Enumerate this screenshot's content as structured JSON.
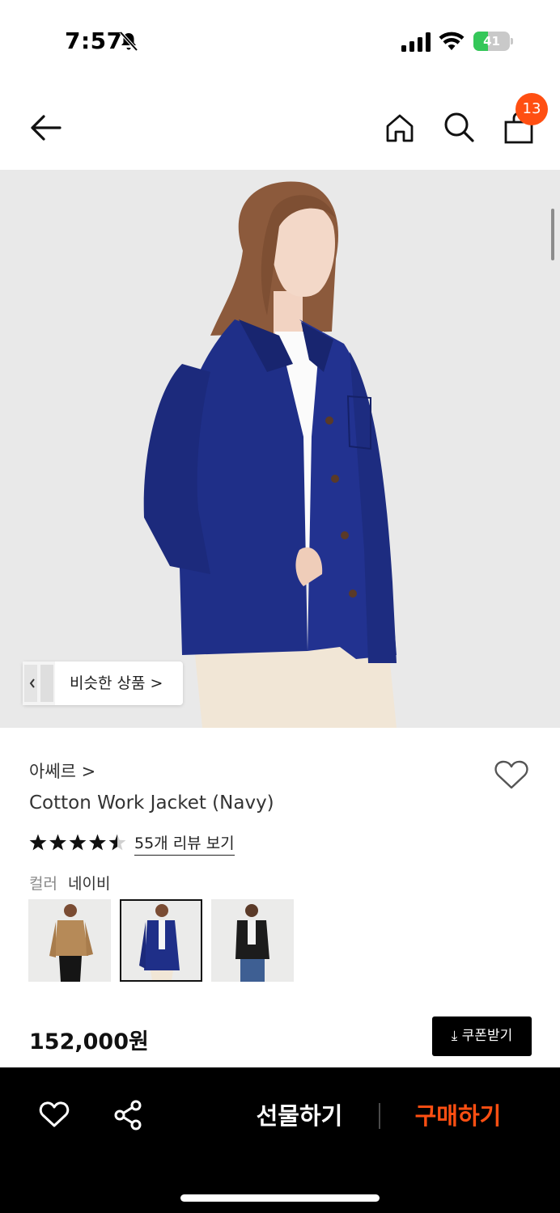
{
  "status_bar": {
    "time": "7:57",
    "battery_level": "41",
    "battery_fraction": 0.41
  },
  "header": {
    "cart_count": "13"
  },
  "colors": {
    "accent": "#ff4f12",
    "navy": "#1f2f88"
  },
  "hero": {
    "similar_products_label": "비슷한 상품 >"
  },
  "product": {
    "brand": "아쎄르 >",
    "name": "Cotton Work Jacket (Navy)",
    "rating": 4.5,
    "review_link": "55개 리뷰 보기",
    "color_label": "컬러",
    "color_value": "네이비",
    "swatches": [
      {
        "name": "camel",
        "selected": false
      },
      {
        "name": "navy",
        "selected": true
      },
      {
        "name": "black",
        "selected": false
      }
    ],
    "price": "152,000원",
    "coupon_label": "⤓ 쿠폰받기"
  },
  "bottom_bar": {
    "gift_label": "선물하기",
    "buy_label": "구매하기"
  }
}
